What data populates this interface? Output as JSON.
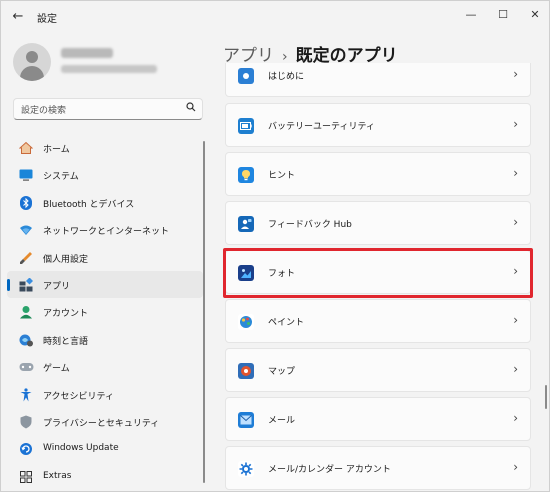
{
  "window": {
    "title": "設定",
    "back_glyph": "←",
    "min_glyph": "—",
    "max_glyph": "☐",
    "close_glyph": "✕"
  },
  "user": {
    "name": "●●●●●",
    "email": "●●●●●●●●●●●●●"
  },
  "search": {
    "placeholder": "設定の検索",
    "icon": "search-icon"
  },
  "nav": {
    "items": [
      {
        "label": "ホーム",
        "icon": "home-icon"
      },
      {
        "label": "システム",
        "icon": "system-icon"
      },
      {
        "label": "Bluetooth とデバイス",
        "icon": "bluetooth-icon"
      },
      {
        "label": "ネットワークとインターネット",
        "icon": "wifi-icon"
      },
      {
        "label": "個人用設定",
        "icon": "brush-icon"
      },
      {
        "label": "アプリ",
        "icon": "apps-icon",
        "selected": true
      },
      {
        "label": "アカウント",
        "icon": "account-icon"
      },
      {
        "label": "時刻と言語",
        "icon": "time-language-icon"
      },
      {
        "label": "ゲーム",
        "icon": "gamepad-icon"
      },
      {
        "label": "アクセシビリティ",
        "icon": "accessibility-icon"
      },
      {
        "label": "プライバシーとセキュリティ",
        "icon": "shield-icon"
      },
      {
        "label": "Windows Update",
        "icon": "windows-update-icon"
      },
      {
        "label": "Extras",
        "icon": "extras-icon"
      }
    ]
  },
  "header": {
    "parent": "アプリ",
    "separator": "›",
    "current": "既定のアプリ"
  },
  "apps": [
    {
      "label": "はじめに",
      "icon": "tips-start-icon"
    },
    {
      "label": "バッテリーユーティリティ",
      "icon": "battery-utility-icon"
    },
    {
      "label": "ヒント",
      "icon": "tips-icon"
    },
    {
      "label": "フィードバック Hub",
      "icon": "feedback-hub-icon"
    },
    {
      "label": "フォト",
      "icon": "photos-icon",
      "highlighted": true
    },
    {
      "label": "ペイント",
      "icon": "paint-icon"
    },
    {
      "label": "マップ",
      "icon": "maps-icon"
    },
    {
      "label": "メール",
      "icon": "mail-icon"
    },
    {
      "label": "メール/カレンダー アカウント",
      "icon": "mail-calendar-icon"
    }
  ],
  "chevron": "›",
  "colors": {
    "accent": "#0067c0",
    "highlight": "#e0262e",
    "background": "#f3f3f3",
    "card": "#fbfbfb"
  }
}
